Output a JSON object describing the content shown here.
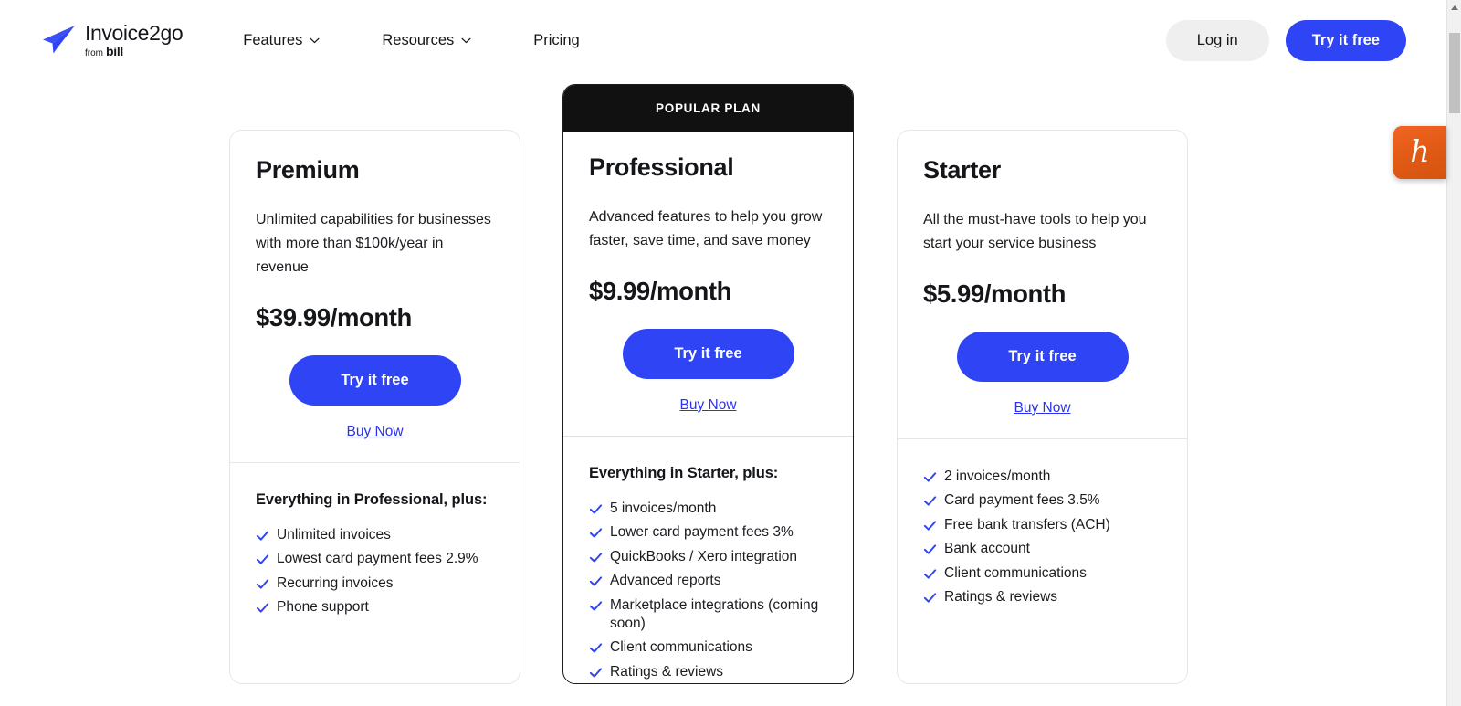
{
  "brand": {
    "accent_blue": "#2f44f5",
    "link_blue": "#2a32ef",
    "badge_black": "#111111",
    "honey_orange": "#f26322",
    "logo_title": "Invoice2go",
    "logo_from": "from",
    "logo_bill": "bill",
    "logo_icon": "paper-plane-icon"
  },
  "header": {
    "nav": [
      {
        "label": "Features",
        "has_dropdown": true,
        "icon": "chevron-down-icon"
      },
      {
        "label": "Resources",
        "has_dropdown": true,
        "icon": "chevron-down-icon"
      },
      {
        "label": "Pricing",
        "has_dropdown": false,
        "icon": ""
      }
    ],
    "login_label": "Log in",
    "try_free_label": "Try it free"
  },
  "honey": {
    "icon": "honey-extension-icon",
    "glyph": "h"
  },
  "scrollbar": {
    "up_arrow_icon": "scroll-up-arrow-icon"
  },
  "pricing": {
    "popular_badge": "POPULAR PLAN",
    "plans": [
      {
        "name": "Premium",
        "description": "Unlimited capabilities for businesses with more than $100k/year in revenue",
        "price": "$39.99/month",
        "cta_label": "Try it free",
        "secondary_label": "Buy Now",
        "features_heading": "Everything in Professional, plus:",
        "features": [
          "Unlimited invoices",
          "Lowest card payment fees 2.9%",
          "Recurring invoices",
          "Phone support"
        ]
      },
      {
        "name": "Professional",
        "description": "Advanced features to help you grow faster, save time, and save money",
        "price": "$9.99/month",
        "cta_label": "Try it free",
        "secondary_label": "Buy Now",
        "features_heading": "Everything in Starter, plus:",
        "features": [
          "5 invoices/month",
          "Lower card payment fees 3%",
          "QuickBooks / Xero integration",
          "Advanced reports",
          "Marketplace integrations (coming soon)",
          "Client communications",
          "Ratings & reviews"
        ]
      },
      {
        "name": "Starter",
        "description": "All the must-have tools to help you start your service business",
        "price": "$5.99/month",
        "cta_label": "Try it free",
        "secondary_label": "Buy Now",
        "features_heading": "",
        "features": [
          "2 invoices/month",
          "Card payment fees 3.5%",
          "Free bank transfers (ACH)",
          "Bank account",
          "Client communications",
          "Ratings & reviews"
        ]
      }
    ]
  }
}
